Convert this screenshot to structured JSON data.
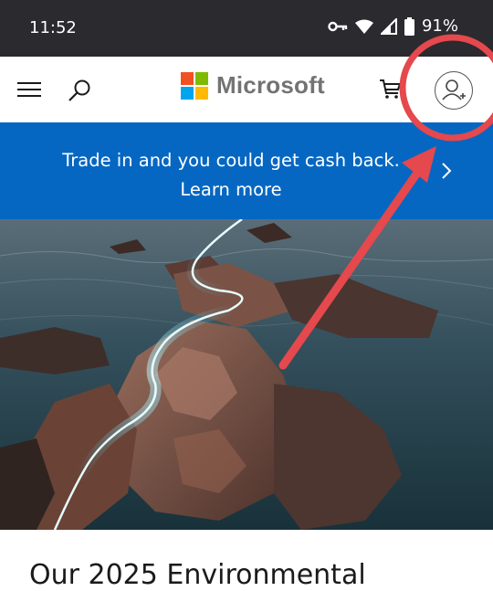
{
  "status_bar": {
    "time": "11:52",
    "battery": "91%"
  },
  "header": {
    "logo_text": "Microsoft",
    "logo_colors": [
      "#f25022",
      "#7fba00",
      "#00a4ef",
      "#ffb900"
    ]
  },
  "banner": {
    "text": "Trade in and you could get cash back. Learn more",
    "color": "#0667c2"
  },
  "hero": {
    "image": "glowing path winding over coastal rocks at dusk"
  },
  "article": {
    "heading": "Our 2025 Environmental"
  },
  "annotation": {
    "color": "#e5484d"
  },
  "icons": [
    "menu-icon",
    "search-icon",
    "cart-icon",
    "account-add-icon",
    "chevron-right-icon",
    "vpn-key-icon",
    "wifi-icon",
    "signal-icon",
    "battery-icon"
  ]
}
